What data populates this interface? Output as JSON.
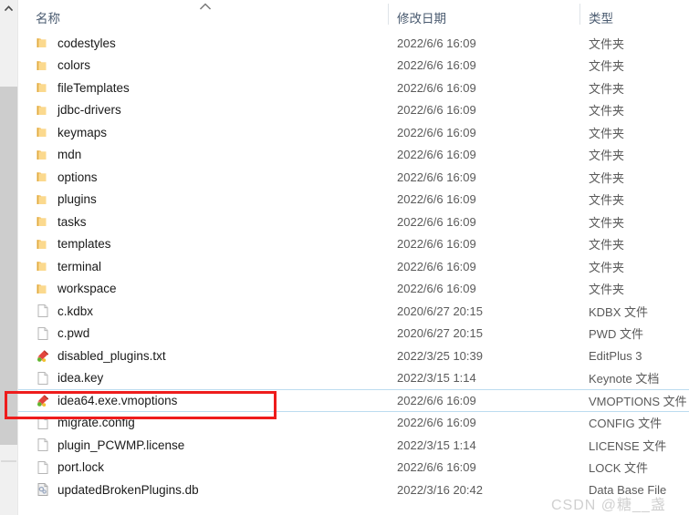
{
  "columns": {
    "name": "名称",
    "date": "修改日期",
    "type": "类型",
    "sort_icon": "sort-ascending-caret-icon"
  },
  "scrollbar": {
    "up_arrow_icon": "chevron-up-icon"
  },
  "watermark": "CSDN @糖__盏",
  "highlight": {
    "target_row_index": 16,
    "color": "#ee1c1c"
  },
  "rows": [
    {
      "name": "codestyles",
      "date": "2022/6/6 16:09",
      "type": "文件夹",
      "icon": "folder-icon"
    },
    {
      "name": "colors",
      "date": "2022/6/6 16:09",
      "type": "文件夹",
      "icon": "folder-icon"
    },
    {
      "name": "fileTemplates",
      "date": "2022/6/6 16:09",
      "type": "文件夹",
      "icon": "folder-icon"
    },
    {
      "name": "jdbc-drivers",
      "date": "2022/6/6 16:09",
      "type": "文件夹",
      "icon": "folder-icon"
    },
    {
      "name": "keymaps",
      "date": "2022/6/6 16:09",
      "type": "文件夹",
      "icon": "folder-icon"
    },
    {
      "name": "mdn",
      "date": "2022/6/6 16:09",
      "type": "文件夹",
      "icon": "folder-icon"
    },
    {
      "name": "options",
      "date": "2022/6/6 16:09",
      "type": "文件夹",
      "icon": "folder-icon"
    },
    {
      "name": "plugins",
      "date": "2022/6/6 16:09",
      "type": "文件夹",
      "icon": "folder-icon"
    },
    {
      "name": "tasks",
      "date": "2022/6/6 16:09",
      "type": "文件夹",
      "icon": "folder-icon"
    },
    {
      "name": "templates",
      "date": "2022/6/6 16:09",
      "type": "文件夹",
      "icon": "folder-icon"
    },
    {
      "name": "terminal",
      "date": "2022/6/6 16:09",
      "type": "文件夹",
      "icon": "folder-icon"
    },
    {
      "name": "workspace",
      "date": "2022/6/6 16:09",
      "type": "文件夹",
      "icon": "folder-icon"
    },
    {
      "name": "c.kdbx",
      "date": "2020/6/27 20:15",
      "type": "KDBX 文件",
      "icon": "generic-file-icon"
    },
    {
      "name": "c.pwd",
      "date": "2020/6/27 20:15",
      "type": "PWD 文件",
      "icon": "generic-file-icon"
    },
    {
      "name": "disabled_plugins.txt",
      "date": "2022/3/25 10:39",
      "type": "EditPlus 3",
      "icon": "editplus-file-icon"
    },
    {
      "name": "idea.key",
      "date": "2022/3/15 1:14",
      "type": "Keynote 文档",
      "icon": "generic-file-icon"
    },
    {
      "name": "idea64.exe.vmoptions",
      "date": "2022/6/6 16:09",
      "type": "VMOPTIONS 文件",
      "icon": "editplus-file-icon"
    },
    {
      "name": "migrate.config",
      "date": "2022/6/6 16:09",
      "type": "CONFIG 文件",
      "icon": "generic-file-icon"
    },
    {
      "name": "plugin_PCWMP.license",
      "date": "2022/3/15 1:14",
      "type": "LICENSE 文件",
      "icon": "generic-file-icon"
    },
    {
      "name": "port.lock",
      "date": "2022/6/6 16:09",
      "type": "LOCK 文件",
      "icon": "generic-file-icon"
    },
    {
      "name": "updatedBrokenPlugins.db",
      "date": "2022/3/16 20:42",
      "type": "Data Base File",
      "icon": "database-file-icon"
    }
  ]
}
